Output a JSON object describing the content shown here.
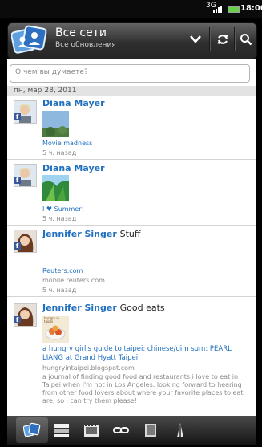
{
  "status": {
    "signal": "3G",
    "time": "18:00"
  },
  "header": {
    "title": "Все сети",
    "subtitle": "Все обновления"
  },
  "search": {
    "placeholder": "О чем вы думаете?"
  },
  "date_header": "пн, мар 28, 2011",
  "posts": [
    {
      "name": "Diana Mayer",
      "text": "",
      "caption": "Movie madness",
      "time": "5 ч. назад",
      "network": "f"
    },
    {
      "name": "Diana Mayer",
      "text": "",
      "caption": "I ♥ Summer!",
      "time": "5 ч. назад",
      "network": "f"
    },
    {
      "name": "Jennifer Singer",
      "text": "Stuff",
      "link_title": "Reuters.com",
      "link_domain": "mobile.reuters.com",
      "time": "5 ч. назад",
      "network": "f"
    },
    {
      "name": "Jennifer Singer",
      "text": "Good eats",
      "thumb_label": "hungry in taipei",
      "link_title": "a hungry girl's guide to taipei: chinese/dim sum: PEARL LIANG at Grand Hyatt Taipei",
      "link_domain": "hungryintaipei.blogspot.com",
      "description": "a journal of finding good food and restaurants i love to eat in Taipei when I'm not in Los Angeles. looking forward to hearing from other food lovers about where your favorite places to eat are, so i can try them please!",
      "network": "f"
    }
  ],
  "colors": {
    "link": "#1f6fbf",
    "facebook": "#3b5998",
    "battery": "#69d04a"
  }
}
